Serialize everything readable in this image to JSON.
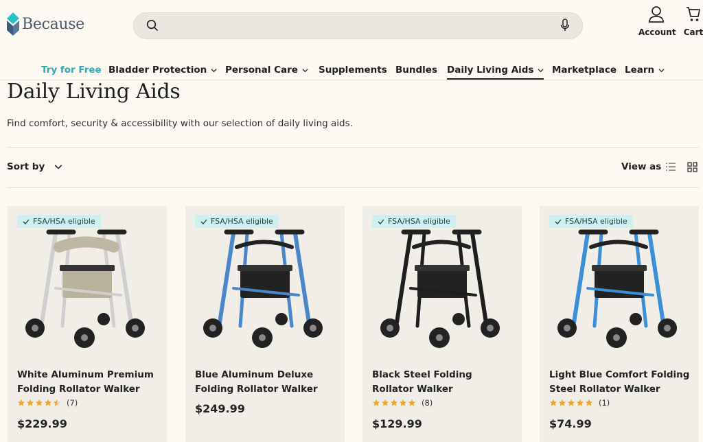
{
  "header": {
    "logo_text": "Because",
    "search_placeholder": "",
    "account_label": "Account",
    "cart_label": "Cart"
  },
  "nav": [
    {
      "label": "Try for Free"
    },
    {
      "label": "Bladder Protection"
    },
    {
      "label": "Personal Care"
    },
    {
      "label": "Supplements"
    },
    {
      "label": "Bundles"
    },
    {
      "label": "Daily Living Aids"
    },
    {
      "label": "Marketplace"
    },
    {
      "label": "Learn"
    }
  ],
  "page": {
    "title": "Daily Living Aids",
    "description": "Find comfort, security & accessibility with our selection of daily living aids."
  },
  "toolbar": {
    "sort_label": "Sort by",
    "view_label": "View as"
  },
  "products": [
    {
      "badge": "FSA/HSA eligible",
      "title": "White Aluminum Premium Folding Rollator Walker",
      "rating_count": "(7)",
      "price": "$229.99",
      "stars": 4.5,
      "frame_color": "#f4f4f4"
    },
    {
      "badge": "FSA/HSA eligible",
      "title": "Blue Aluminum Deluxe Folding Rollator Walker",
      "rating_count": "",
      "price": "$249.99",
      "stars": 0,
      "frame_color": "#4a86c8"
    },
    {
      "badge": "FSA/HSA eligible",
      "title": "Black Steel Folding Rollator Walker",
      "rating_count": "(8)",
      "price": "$129.99",
      "stars": 5,
      "frame_color": "#1e1e1e"
    },
    {
      "badge": "FSA/HSA eligible",
      "title": "Light Blue Comfort Folding Steel Rollator Walker",
      "rating_count": "(1)",
      "price": "$74.99",
      "stars": 5,
      "frame_color": "#3b8fd6"
    }
  ],
  "colors": {
    "accent": "#2ea9b5",
    "background": "#fbf9f1",
    "card_bg": "#f0eee7",
    "badge_bg": "#cfeff0",
    "star": "#f2a51f"
  }
}
